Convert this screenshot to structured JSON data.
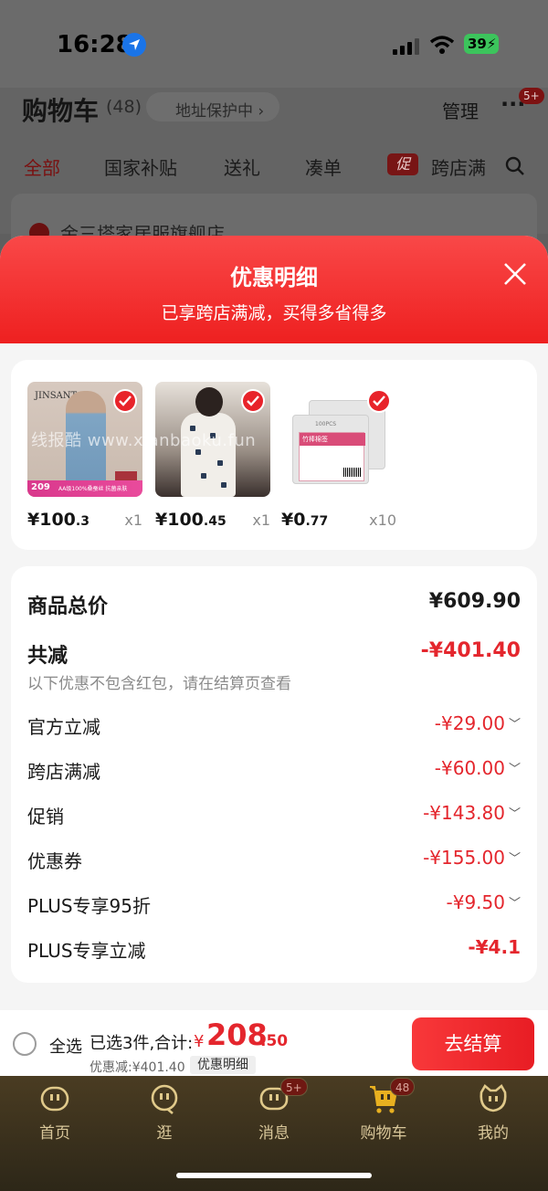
{
  "status_bar": {
    "time": "16:28",
    "battery": "39"
  },
  "background_page": {
    "title": "购物车",
    "count": "(48)",
    "address_pill": "地址保护中",
    "manage": "管理",
    "more_badge": "5+",
    "tabs": [
      "全部",
      "国家补贴",
      "送礼",
      "凑单",
      "跨店满"
    ],
    "promo_tag": "促",
    "shop_name": "金三塔家居服旗舰店"
  },
  "modal": {
    "title": "优惠明细",
    "subtitle": "已享跨店满减，买得多省得多",
    "products": [
      {
        "price_int": "¥100",
        "price_dec": ".3",
        "qty": "x1",
        "brand": "JINSANT",
        "banner": "209",
        "banner_text": "AA级100%桑蚕丝 抗菌亲肤"
      },
      {
        "price_int": "¥100",
        "price_dec": ".45",
        "qty": "x1"
      },
      {
        "price_int": "¥0",
        "price_dec": ".77",
        "qty": "x10",
        "pack_label": "竹棒棉签",
        "pack_count": "100PCS"
      }
    ],
    "watermark": "线报酷 www.xianbaoku.fun",
    "summary": {
      "total_label": "商品总价",
      "total_value": "¥609.90",
      "reduce_label": "共减",
      "reduce_value": "-¥401.40",
      "note": "以下优惠不包含红包，请在结算页查看",
      "items": [
        {
          "label": "官方立减",
          "value": "-¥29.00"
        },
        {
          "label": "跨店满减",
          "value": "-¥60.00"
        },
        {
          "label": "促销",
          "value": "-¥143.80"
        },
        {
          "label": "优惠券",
          "value": "-¥155.00"
        },
        {
          "label": "PLUS专享95折",
          "value": "-¥9.50"
        },
        {
          "label": "PLUS专享立减",
          "value": "-¥4.1"
        }
      ]
    }
  },
  "checkout": {
    "select_all": "全选",
    "selected": "已选3件,合计:",
    "currency": "¥",
    "total_int": "208",
    "total_dec": ".50",
    "discount": "优惠减:¥401.40",
    "detail_chip": "优惠明细",
    "button": "去结算"
  },
  "tabbar": [
    {
      "label": "首页"
    },
    {
      "label": "逛"
    },
    {
      "label": "消息",
      "badge": "5+"
    },
    {
      "label": "购物车",
      "badge": "48"
    },
    {
      "label": "我的"
    }
  ]
}
